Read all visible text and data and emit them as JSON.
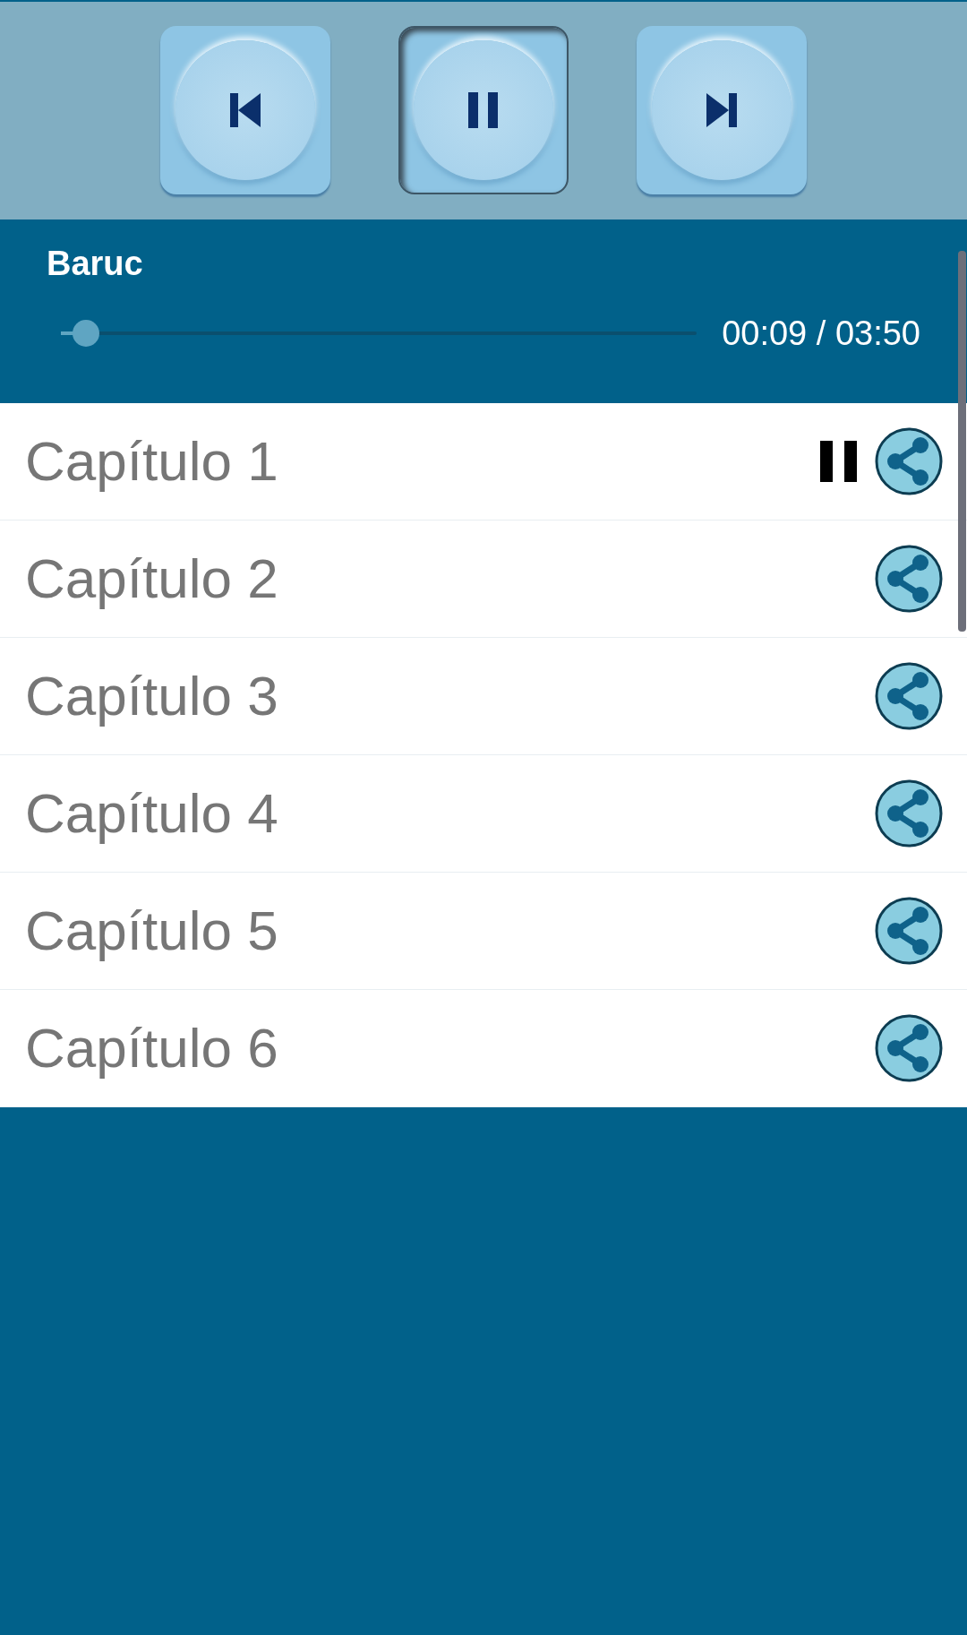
{
  "controls": [
    {
      "kind": "previous",
      "selected": false
    },
    {
      "kind": "pause",
      "selected": true
    },
    {
      "kind": "next",
      "selected": false
    }
  ],
  "player": {
    "title": "Baruc",
    "level": 0.04,
    "time": "00:09 / 03:50"
  },
  "tracks": [
    {
      "label": "Capítulo 1",
      "playing": true
    },
    {
      "label": "Capítulo 2",
      "playing": false
    },
    {
      "label": "Capítulo 3",
      "playing": false
    },
    {
      "label": "Capítulo 4",
      "playing": false
    },
    {
      "label": "Capítulo 5",
      "playing": false
    },
    {
      "label": "Capítulo 6",
      "playing": false
    }
  ]
}
